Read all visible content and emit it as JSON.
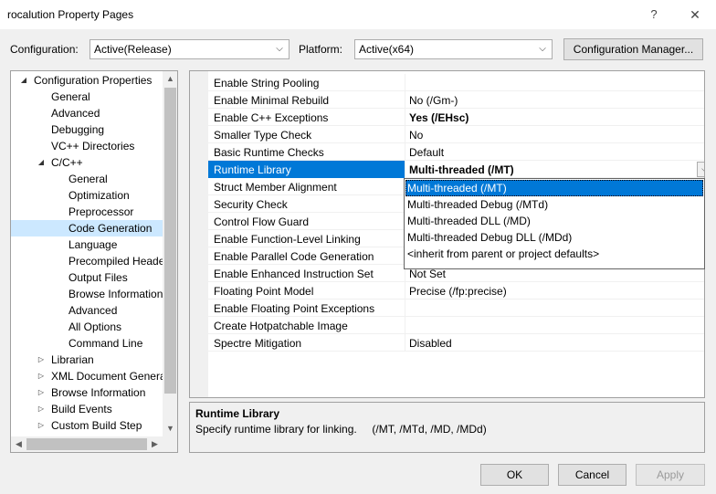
{
  "window": {
    "title": "rocalution Property Pages",
    "help": "?",
    "close": "✕"
  },
  "toolbar": {
    "configuration_label": "Configuration:",
    "configuration_value": "Active(Release)",
    "platform_label": "Platform:",
    "platform_value": "Active(x64)",
    "config_manager_label": "Configuration Manager..."
  },
  "tree": {
    "items": [
      {
        "label": "Configuration Properties",
        "expander": "◢"
      },
      {
        "label": "General"
      },
      {
        "label": "Advanced"
      },
      {
        "label": "Debugging"
      },
      {
        "label": "VC++ Directories"
      },
      {
        "label": "C/C++",
        "expander": "◢"
      },
      {
        "label": "General"
      },
      {
        "label": "Optimization"
      },
      {
        "label": "Preprocessor"
      },
      {
        "label": "Code Generation"
      },
      {
        "label": "Language"
      },
      {
        "label": "Precompiled Heade"
      },
      {
        "label": "Output Files"
      },
      {
        "label": "Browse Information"
      },
      {
        "label": "Advanced"
      },
      {
        "label": "All Options"
      },
      {
        "label": "Command Line"
      },
      {
        "label": "Librarian",
        "expander": "▷"
      },
      {
        "label": "XML Document Genera",
        "expander": "▷"
      },
      {
        "label": "Browse Information",
        "expander": "▷"
      },
      {
        "label": "Build Events",
        "expander": "▷"
      },
      {
        "label": "Custom Build Step",
        "expander": "▷"
      }
    ]
  },
  "properties": [
    {
      "name": "Enable String Pooling",
      "value": ""
    },
    {
      "name": "Enable Minimal Rebuild",
      "value": "No (/Gm-)"
    },
    {
      "name": "Enable C++ Exceptions",
      "value": "Yes (/EHsc)"
    },
    {
      "name": "Smaller Type Check",
      "value": "No"
    },
    {
      "name": "Basic Runtime Checks",
      "value": "Default"
    },
    {
      "name": "Runtime Library",
      "value": "Multi-threaded (/MT)"
    },
    {
      "name": "Struct Member Alignment",
      "value": ""
    },
    {
      "name": "Security Check",
      "value": ""
    },
    {
      "name": "Control Flow Guard",
      "value": ""
    },
    {
      "name": "Enable Function-Level Linking",
      "value": ""
    },
    {
      "name": "Enable Parallel Code Generation",
      "value": ""
    },
    {
      "name": "Enable Enhanced Instruction Set",
      "value": "Not Set"
    },
    {
      "name": "Floating Point Model",
      "value": "Precise (/fp:precise)"
    },
    {
      "name": "Enable Floating Point Exceptions",
      "value": ""
    },
    {
      "name": "Create Hotpatchable Image",
      "value": ""
    },
    {
      "name": "Spectre Mitigation",
      "value": "Disabled"
    }
  ],
  "dropdown": {
    "options": [
      "Multi-threaded (/MT)",
      "Multi-threaded Debug (/MTd)",
      "Multi-threaded DLL (/MD)",
      "Multi-threaded Debug DLL (/MDd)",
      "<inherit from parent or project defaults>"
    ]
  },
  "description": {
    "title": "Runtime Library",
    "text": "Specify runtime library for linking.     (/MT, /MTd, /MD, /MDd)"
  },
  "buttons": {
    "ok": "OK",
    "cancel": "Cancel",
    "apply": "Apply"
  },
  "icons": {
    "combo_arrow": "⌵",
    "scroll_up": "▲",
    "scroll_down": "▼",
    "scroll_left": "◀",
    "scroll_right": "▶"
  }
}
